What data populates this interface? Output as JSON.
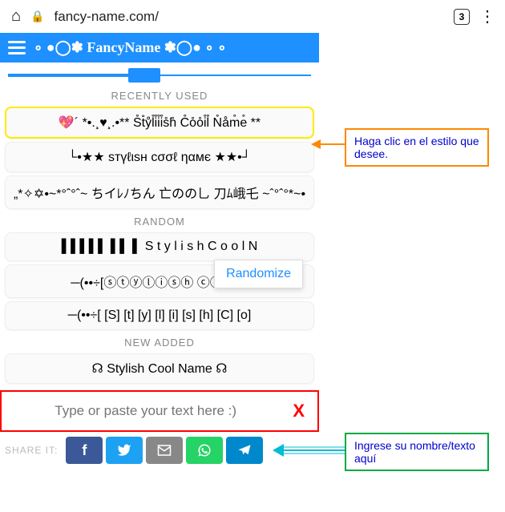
{
  "address_bar": {
    "url": "fancy-name.com/",
    "tab_count": "3"
  },
  "header": {
    "title": "∘ ●◯✽ FancyName ✽◯● ∘ ∘"
  },
  "sections": {
    "recently_used": "RECENTLY USED",
    "random": "RANDOM",
    "new_added": "NEW ADDED"
  },
  "styles": {
    "r1": "💖´ *•.¸♥¸.•** S̊t̊ẙl̊i̊i̊i̊s̊h̊ C̊o̊o̊i̊l̊ N̊åm̊e̊ **",
    "r2": "└•★★ sтүℓιsн cσσℓ ηαмє ★★•┘",
    "r3": "„*✧✡•~*°ˆ°ˆ~ ちイﾚﾉちん 亡のの乚 刀ﾑ峨乇 ~ˆ°ˆ°*~•",
    "rnd1": "▌▌▌▌▌ ▌▌ ▌ S t y l i s h C o o l N",
    "rnd2": "─(••÷[ⓢⓣⓨⓛⓘⓢⓗ ⓒⓞⓞⓛ",
    "rnd3": "─(••÷[ [S] [t] [y] [l] [i] [s] [h]  [C] [o]",
    "new1": "☊ Stylish Cool Name ☊"
  },
  "randomize_label": "Randomize",
  "input": {
    "placeholder": "Type or paste your text here :)",
    "clear": "X"
  },
  "share": {
    "label": "SHARE IT:"
  },
  "callouts": {
    "style": "Haga clic en el estilo que desee.",
    "input": "Ingrese su nombre/texto aquí"
  }
}
